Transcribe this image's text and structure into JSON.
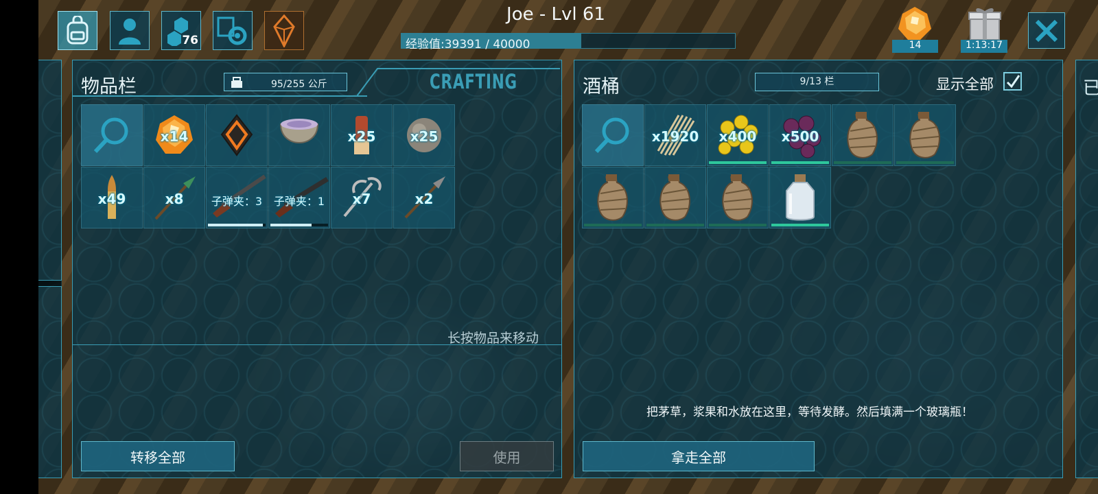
{
  "header": {
    "player_title": "Joe - Lvl 61",
    "xp_text": "经验值:39391 / 40000",
    "xp_progress": 0.54,
    "engram_points": "76",
    "gem_count": "14",
    "gift_timer": "1:13:17"
  },
  "inventory": {
    "title": "物品栏",
    "weight": "95/255 公斤",
    "crafting_tab": "CRAFTING",
    "hint": "长按物品来移动",
    "transfer_all": "转移全部",
    "use": "使用",
    "items": [
      {
        "name": "search",
        "qty": ""
      },
      {
        "name": "amber",
        "qty": "x14"
      },
      {
        "name": "element",
        "qty": ""
      },
      {
        "name": "mortar-and-pestle",
        "qty": ""
      },
      {
        "name": "simple-rifle-ammo",
        "qty": "x25"
      },
      {
        "name": "stone-ball",
        "qty": "x25"
      },
      {
        "name": "bullet",
        "qty": "x49"
      },
      {
        "name": "spear",
        "qty": "x8"
      },
      {
        "name": "rifle",
        "qty": "子弹夹：3",
        "durability": 0.95
      },
      {
        "name": "shotgun",
        "qty": "子弹夹：1",
        "durability": 0.72
      },
      {
        "name": "grappling-hook",
        "qty": "x7"
      },
      {
        "name": "arrow",
        "qty": "x2"
      }
    ]
  },
  "barrel": {
    "title": "酒桶",
    "slots": "9/13 栏",
    "show_all": "显示全部",
    "description": "把茅草，浆果和水放在这里，等待发酵。然后填满一个玻璃瓶！",
    "take_all": "拿走全部",
    "items": [
      {
        "name": "search",
        "qty": ""
      },
      {
        "name": "thatch",
        "qty": "x1920"
      },
      {
        "name": "yellow-berries",
        "qty": "x400",
        "durability": 1.0
      },
      {
        "name": "purple-berries",
        "qty": "x500",
        "durability": 1.0
      },
      {
        "name": "waterskin",
        "qty": "",
        "durability": 0.0
      },
      {
        "name": "waterskin",
        "qty": "",
        "durability": 0.0
      },
      {
        "name": "waterskin",
        "qty": "",
        "durability": 0.0
      },
      {
        "name": "waterskin",
        "qty": "",
        "durability": 0.0
      },
      {
        "name": "waterskin",
        "qty": "",
        "durability": 0.0
      },
      {
        "name": "glass-bottle",
        "qty": "",
        "durability": 1.0
      }
    ]
  },
  "edge_right_text": "已",
  "colors": {
    "accent": "#3a9db5",
    "bar_green": "#2ec79b",
    "bar_white": "#cfeef5"
  }
}
